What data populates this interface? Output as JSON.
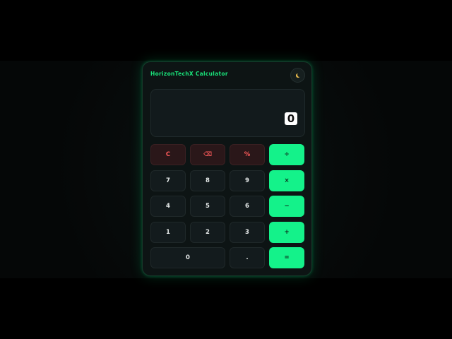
{
  "app": {
    "title": "HorizonTechX Calculator",
    "theme_icon": "moon-icon"
  },
  "display": {
    "value": "0"
  },
  "keypad": {
    "rows": [
      [
        {
          "label": "C",
          "kind": "function"
        },
        {
          "label": "⌫",
          "kind": "function"
        },
        {
          "label": "%",
          "kind": "function"
        },
        {
          "label": "÷",
          "kind": "operator"
        }
      ],
      [
        {
          "label": "7",
          "kind": "digit"
        },
        {
          "label": "8",
          "kind": "digit"
        },
        {
          "label": "9",
          "kind": "digit"
        },
        {
          "label": "×",
          "kind": "operator"
        }
      ],
      [
        {
          "label": "4",
          "kind": "digit"
        },
        {
          "label": "5",
          "kind": "digit"
        },
        {
          "label": "6",
          "kind": "digit"
        },
        {
          "label": "−",
          "kind": "operator"
        }
      ],
      [
        {
          "label": "1",
          "kind": "digit"
        },
        {
          "label": "2",
          "kind": "digit"
        },
        {
          "label": "3",
          "kind": "digit"
        },
        {
          "label": "+",
          "kind": "operator"
        }
      ],
      [
        {
          "label": "0",
          "kind": "digit"
        },
        {
          "label": ".",
          "kind": "digit"
        },
        {
          "label": "=",
          "kind": "operator"
        }
      ]
    ]
  },
  "colors": {
    "accent": "#14f28a",
    "title": "#19e27a",
    "function_key_text": "#ff5b5b",
    "function_key_bg": "#2a1719",
    "digit_key_bg": "#131b1d",
    "panel_bg": "#0d1414"
  }
}
